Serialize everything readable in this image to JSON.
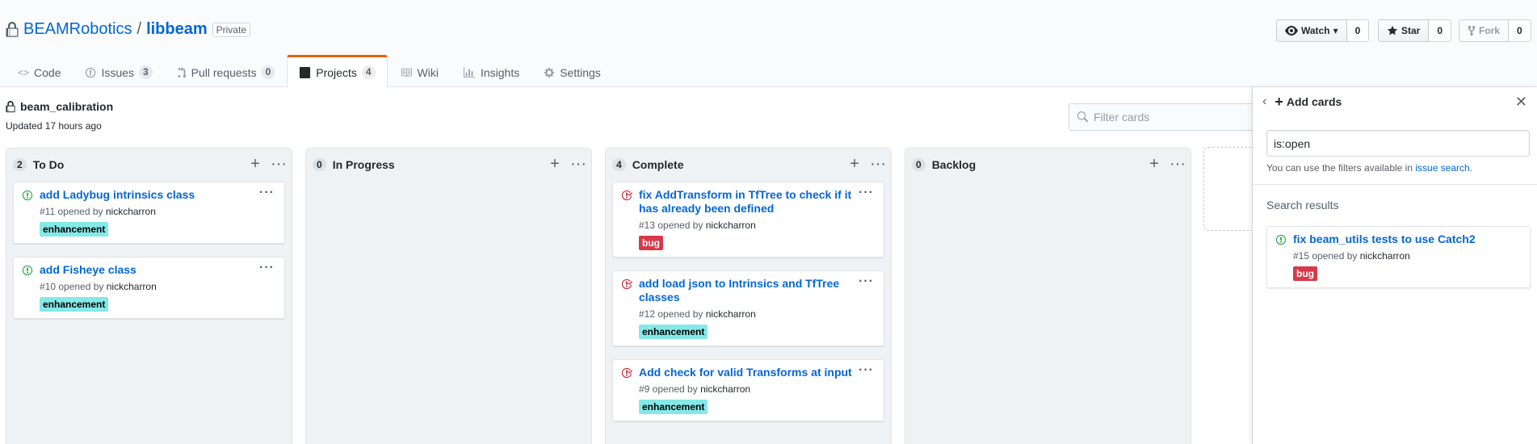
{
  "repo": {
    "owner": "BEAMRobotics",
    "separator": "/",
    "name": "libbeam",
    "visibility": "Private"
  },
  "actions": {
    "watch": {
      "label": "Watch",
      "count": "0"
    },
    "star": {
      "label": "Star",
      "count": "0"
    },
    "fork": {
      "label": "Fork",
      "count": "0"
    }
  },
  "nav": [
    {
      "label": "Code",
      "icon": "code-icon",
      "count": ""
    },
    {
      "label": "Issues",
      "icon": "issue-opened-icon",
      "count": "3"
    },
    {
      "label": "Pull requests",
      "icon": "git-pull-request-icon",
      "count": "0"
    },
    {
      "label": "Projects",
      "icon": "project-icon",
      "count": "4",
      "selected": true
    },
    {
      "label": "Wiki",
      "icon": "book-icon",
      "count": ""
    },
    {
      "label": "Insights",
      "icon": "graph-icon",
      "count": ""
    },
    {
      "label": "Settings",
      "icon": "gear-icon",
      "count": ""
    }
  ],
  "project": {
    "name": "beam_calibration",
    "updated": "Updated 17 hours ago",
    "filter_placeholder": "Filter cards"
  },
  "columns": [
    {
      "name": "To Do",
      "count": "2",
      "cards": [
        {
          "title": "add Ladybug intrinsics class",
          "number": "#11 opened by",
          "user": "nickcharron",
          "label": "enhancement",
          "label_type": "enh",
          "state": "open"
        },
        {
          "title": "add Fisheye class",
          "number": "#10 opened by",
          "user": "nickcharron",
          "label": "enhancement",
          "label_type": "enh",
          "state": "open"
        }
      ]
    },
    {
      "name": "In Progress",
      "count": "0",
      "cards": []
    },
    {
      "name": "Complete",
      "count": "4",
      "cards": [
        {
          "title": "fix AddTransform in TfTree to check if it has already been defined",
          "number": "#13 opened by",
          "user": "nickcharron",
          "label": "bug",
          "label_type": "bug",
          "state": "closed"
        },
        {
          "title": "add load json to Intrinsics and TfTree classes",
          "number": "#12 opened by",
          "user": "nickcharron",
          "label": "enhancement",
          "label_type": "enh",
          "state": "closed"
        },
        {
          "title": "Add check for valid Transforms at input",
          "number": "#9 opened by",
          "user": "nickcharron",
          "label": "enhancement",
          "label_type": "enh",
          "state": "closed"
        }
      ]
    },
    {
      "name": "Backlog",
      "count": "0",
      "cards": []
    }
  ],
  "panel": {
    "title": "Add cards",
    "search_value": "is:open",
    "hint_text": "You can use the filters available in",
    "hint_link": "issue search.",
    "results_heading": "Search results",
    "result": {
      "title": "fix beam_utils tests to use Catch2",
      "number": "#15 opened by",
      "user": "nickcharron",
      "label": "bug",
      "label_type": "bug",
      "state": "open"
    }
  },
  "colors": {
    "link": "#0366d6",
    "open_issue": "#28a745",
    "closed_issue": "#cb2431",
    "enhancement": "#84e9e7",
    "bug": "#d73a4a",
    "selected_tab_accent": "#e36209"
  }
}
